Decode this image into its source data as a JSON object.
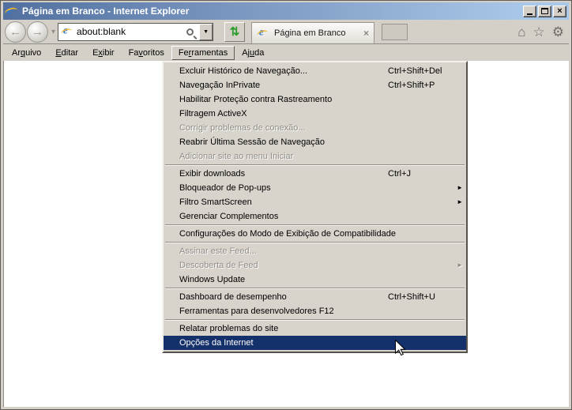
{
  "titlebar": {
    "title": "Página em Branco - Internet Explorer"
  },
  "navbar": {
    "address_value": "about:blank",
    "tab_title": "Página em Branco"
  },
  "menubar": {
    "items": [
      {
        "pre": "Ar",
        "accel": "q",
        "post": "uivo",
        "name": "arquivo"
      },
      {
        "pre": "",
        "accel": "E",
        "post": "ditar",
        "name": "editar"
      },
      {
        "pre": "E",
        "accel": "x",
        "post": "ibir",
        "name": "exibir"
      },
      {
        "pre": "Fa",
        "accel": "v",
        "post": "oritos",
        "name": "favoritos"
      },
      {
        "pre": "Fe",
        "accel": "r",
        "post": "ramentas",
        "name": "ferramentas",
        "active": true
      },
      {
        "pre": "Aj",
        "accel": "u",
        "post": "da",
        "name": "ajuda"
      }
    ]
  },
  "tools_menu": {
    "items": [
      {
        "label": "Excluir Histórico de Navegação...",
        "shortcut": "Ctrl+Shift+Del"
      },
      {
        "label": "Navegação InPrivate",
        "shortcut": "Ctrl+Shift+P"
      },
      {
        "label": "Habilitar Proteção contra Rastreamento"
      },
      {
        "label": "Filtragem ActiveX"
      },
      {
        "label": "Corrigir problemas de conexão...",
        "disabled": true
      },
      {
        "label": "Reabrir Última Sessão de Navegação"
      },
      {
        "label": "Adicionar site ao menu Iniciar",
        "disabled": true
      },
      {
        "separator": true
      },
      {
        "label": "Exibir downloads",
        "shortcut": "Ctrl+J"
      },
      {
        "label": "Bloqueador de Pop-ups",
        "submenu": true
      },
      {
        "label": "Filtro SmartScreen",
        "submenu": true
      },
      {
        "label": "Gerenciar Complementos"
      },
      {
        "separator": true
      },
      {
        "label": "Configurações do Modo de Exibição de Compatibilidade"
      },
      {
        "separator": true
      },
      {
        "label": "Assinar este Feed...",
        "disabled": true
      },
      {
        "label": "Descoberta de Feed",
        "disabled": true,
        "submenu": true
      },
      {
        "label": "Windows Update"
      },
      {
        "separator": true
      },
      {
        "label": "Dashboard de desempenho",
        "shortcut": "Ctrl+Shift+U"
      },
      {
        "label": "Ferramentas para desenvolvedores F12"
      },
      {
        "separator": true
      },
      {
        "label": "Relatar problemas do site"
      },
      {
        "label": "Opções da Internet",
        "highlighted": true
      }
    ]
  },
  "icons": {
    "ie_logo": "e",
    "back_arrow": "←",
    "forward_arrow": "→",
    "chevron_down": "▾",
    "dropdown_arrow": "▼",
    "refresh": "⇅",
    "tab_close": "×",
    "home": "⌂",
    "star": "☆",
    "gear": "⚙",
    "submenu_arrow": "►",
    "close_window": "×"
  },
  "colors": {
    "chrome": "#D4D0C8",
    "menu_bg": "#D8D4CC",
    "highlight": "#15316B",
    "disabled_text": "#8F8D86",
    "title_gradient_left": "#52709F",
    "title_gradient_right": "#A9C7E8"
  }
}
